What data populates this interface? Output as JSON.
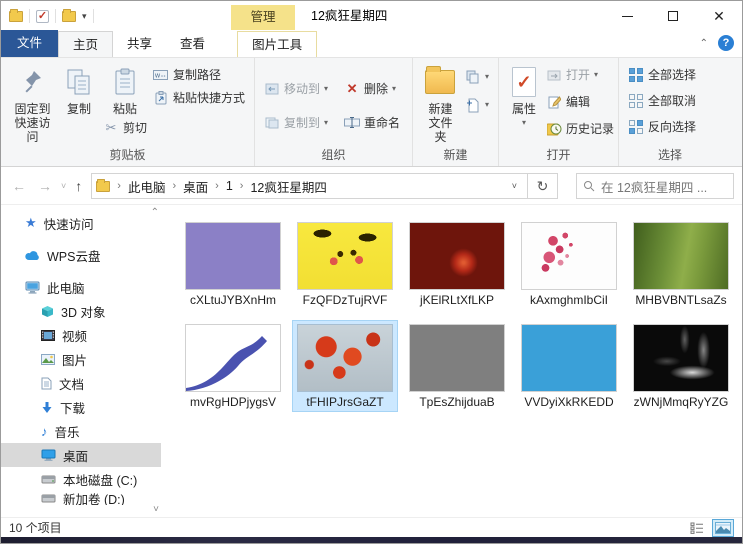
{
  "window": {
    "title": "12疯狂星期四",
    "context_tab": "管理"
  },
  "tabs": [
    {
      "label": "文件"
    },
    {
      "label": "主页"
    },
    {
      "label": "共享"
    },
    {
      "label": "查看"
    },
    {
      "label": "图片工具"
    }
  ],
  "ribbon": {
    "pin": "固定到快速访问",
    "copy": "复制",
    "paste": "粘贴",
    "copy_path": "复制路径",
    "paste_shortcut": "粘贴快捷方式",
    "cut": "剪切",
    "clipboard_group": "剪贴板",
    "move_to": "移动到",
    "copy_to": "复制到",
    "delete": "删除",
    "rename": "重命名",
    "organize_group": "组织",
    "new_folder": "新建文件夹",
    "new_group": "新建",
    "properties": "属性",
    "open": "打开",
    "edit": "编辑",
    "history": "历史记录",
    "open_group": "打开",
    "select_all": "全部选择",
    "select_none": "全部取消",
    "invert_selection": "反向选择",
    "select_group": "选择"
  },
  "address": {
    "breadcrumb": [
      "此电脑",
      "桌面",
      "1",
      "12疯狂星期四"
    ],
    "search_text": "在 12疯狂星期四 ..."
  },
  "sidebar": [
    {
      "label": "快速访问"
    },
    {
      "label": "WPS云盘"
    },
    {
      "label": "此电脑"
    },
    {
      "label": "3D 对象"
    },
    {
      "label": "视频"
    },
    {
      "label": "图片"
    },
    {
      "label": "文档"
    },
    {
      "label": "下载"
    },
    {
      "label": "音乐"
    },
    {
      "label": "桌面",
      "selected": true
    },
    {
      "label": "本地磁盘 (C:)"
    },
    {
      "label": "新加卷 (D:)"
    }
  ],
  "files": [
    {
      "name": "cXLtuJYBXnHm",
      "thumb": "purple",
      "color": "#8b80c6"
    },
    {
      "name": "FzQFDzTujRVF",
      "thumb": "pikachu"
    },
    {
      "name": "jKElRLtXfLKP",
      "thumb": "christmas"
    },
    {
      "name": "kAxmghmIbCiI",
      "thumb": "blossom"
    },
    {
      "name": "MHBVBNTLsaZs",
      "thumb": "field"
    },
    {
      "name": "mvRgHDPjygsV",
      "thumb": "ribbon"
    },
    {
      "name": "tFHIPJrsGaZT",
      "thumb": "maple",
      "selected": true
    },
    {
      "name": "TpEsZhijduaB",
      "thumb": "gray",
      "color": "#7f7f7f"
    },
    {
      "name": "VVDyiXkRKEDD",
      "thumb": "blue",
      "color": "#3aa0d8"
    },
    {
      "name": "zWNjMmqRyYZG",
      "thumb": "smoke"
    }
  ],
  "status": {
    "count": "10 个项目"
  },
  "colors": {
    "file_tab": "#2b5797",
    "manage_tab_bg": "#f5e28a",
    "selection_bg": "#cce8ff",
    "sidebar_selected_bg": "#d9d9d9"
  }
}
